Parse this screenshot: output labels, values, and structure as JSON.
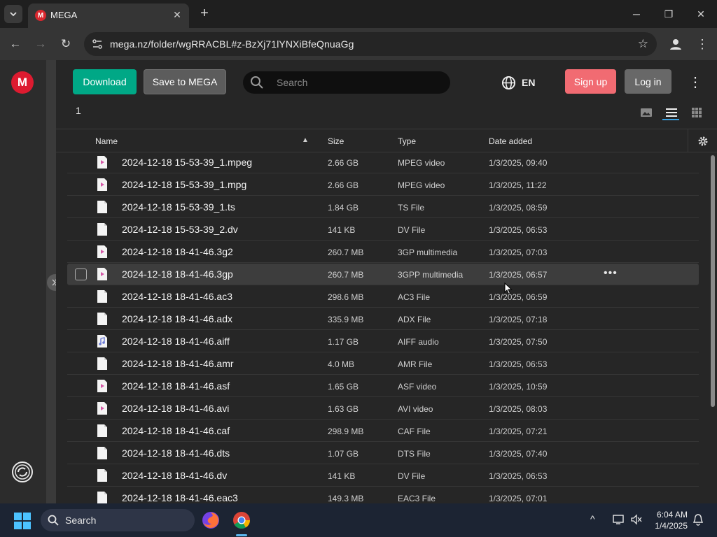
{
  "browser": {
    "tab_title": "MEGA",
    "favicon_letter": "M",
    "url": "mega.nz/folder/wgRRACBL#z-BzXj71lYNXiBfeQnuaGg"
  },
  "header": {
    "download_label": "Download",
    "save_label": "Save to MEGA",
    "search_placeholder": "Search",
    "language": "EN",
    "signup_label": "Sign up",
    "login_label": "Log in"
  },
  "sidebar": {
    "logo_letter": "M"
  },
  "breadcrumb": "1",
  "table": {
    "columns": {
      "name": "Name",
      "size": "Size",
      "type": "Type",
      "date": "Date added"
    },
    "rows": [
      {
        "name": "2024-12-18 15-53-39_1.mpeg",
        "size": "2.66 GB",
        "type": "MPEG video",
        "date": "1/3/2025, 09:40",
        "icon": "video-file-icon"
      },
      {
        "name": "2024-12-18 15-53-39_1.mpg",
        "size": "2.66 GB",
        "type": "MPEG video",
        "date": "1/3/2025, 11:22",
        "icon": "video-file-icon"
      },
      {
        "name": "2024-12-18 15-53-39_1.ts",
        "size": "1.84 GB",
        "type": "TS File",
        "date": "1/3/2025, 08:59",
        "icon": "generic-file-icon"
      },
      {
        "name": "2024-12-18 15-53-39_2.dv",
        "size": "141 KB",
        "type": "DV File",
        "date": "1/3/2025, 06:53",
        "icon": "generic-file-icon"
      },
      {
        "name": "2024-12-18 18-41-46.3g2",
        "size": "260.7 MB",
        "type": "3GP multimedia",
        "date": "1/3/2025, 07:03",
        "icon": "video-file-icon"
      },
      {
        "name": "2024-12-18 18-41-46.3gp",
        "size": "260.7 MB",
        "type": "3GPP multimedia",
        "date": "1/3/2025, 06:57",
        "icon": "video-file-icon",
        "hover": true
      },
      {
        "name": "2024-12-18 18-41-46.ac3",
        "size": "298.6 MB",
        "type": "AC3 File",
        "date": "1/3/2025, 06:59",
        "icon": "generic-file-icon"
      },
      {
        "name": "2024-12-18 18-41-46.adx",
        "size": "335.9 MB",
        "type": "ADX File",
        "date": "1/3/2025, 07:18",
        "icon": "generic-file-icon"
      },
      {
        "name": "2024-12-18 18-41-46.aiff",
        "size": "1.17 GB",
        "type": "AIFF audio",
        "date": "1/3/2025, 07:50",
        "icon": "audio-file-icon"
      },
      {
        "name": "2024-12-18 18-41-46.amr",
        "size": "4.0 MB",
        "type": "AMR File",
        "date": "1/3/2025, 06:53",
        "icon": "generic-file-icon"
      },
      {
        "name": "2024-12-18 18-41-46.asf",
        "size": "1.65 GB",
        "type": "ASF video",
        "date": "1/3/2025, 10:59",
        "icon": "video-file-icon"
      },
      {
        "name": "2024-12-18 18-41-46.avi",
        "size": "1.63 GB",
        "type": "AVI video",
        "date": "1/3/2025, 08:03",
        "icon": "video-file-icon"
      },
      {
        "name": "2024-12-18 18-41-46.caf",
        "size": "298.9 MB",
        "type": "CAF File",
        "date": "1/3/2025, 07:21",
        "icon": "generic-file-icon"
      },
      {
        "name": "2024-12-18 18-41-46.dts",
        "size": "1.07 GB",
        "type": "DTS File",
        "date": "1/3/2025, 07:40",
        "icon": "generic-file-icon"
      },
      {
        "name": "2024-12-18 18-41-46.dv",
        "size": "141 KB",
        "type": "DV File",
        "date": "1/3/2025, 06:53",
        "icon": "generic-file-icon"
      },
      {
        "name": "2024-12-18 18-41-46.eac3",
        "size": "149.3 MB",
        "type": "EAC3 File",
        "date": "1/3/2025, 07:01",
        "icon": "generic-file-icon"
      }
    ]
  },
  "taskbar": {
    "search_label": "Search",
    "time": "6:04 AM",
    "date": "1/4/2025"
  },
  "colors": {
    "download": "#00a886",
    "signup": "#f16b72",
    "brand": "#dd1b30",
    "video_icon": "#d65aa8",
    "audio_icon": "#6b7bd8"
  }
}
